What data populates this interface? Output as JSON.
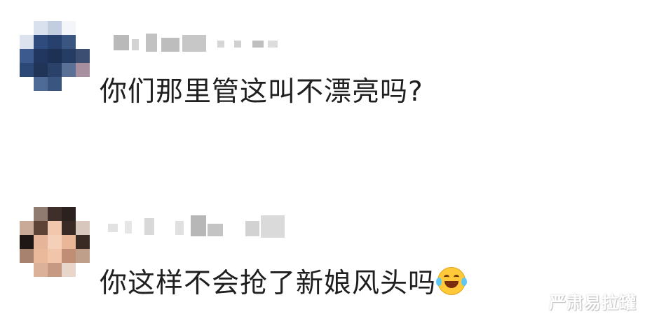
{
  "comments": [
    {
      "text": "你们那里管这叫不漂亮吗?",
      "avatar_colors": [
        "#ffffff",
        "#d9e0ee",
        "#c3cde0",
        "#f3f5f9",
        "#ffffff",
        "#dde3ee",
        "#2f4a7d",
        "#27406d",
        "#3a557f",
        "#ffffff",
        "#3c5a8d",
        "#22375f",
        "#1d3154",
        "#253c63",
        "#3c4f73",
        "#2b4876",
        "#1f3457",
        "#2a416a",
        "#5a7095",
        "#a88fa0",
        "#ffffff",
        "#4e6a97",
        "#3a5580",
        "#ffffff",
        "#ffffff"
      ]
    },
    {
      "text": "你这样不会抢了新娘风头吗",
      "emoji": "laughing-tears-emoji",
      "avatar_colors": [
        "#ffffff",
        "#8f7b70",
        "#3e2f2a",
        "#2b2220",
        "#ffffff",
        "#c9aa98",
        "#5d4236",
        "#f1c8ad",
        "#3a2a25",
        "#d8c7bd",
        "#1f1715",
        "#e6b499",
        "#f4d0b8",
        "#e9b698",
        "#3a2a24",
        "#a6826f",
        "#eab99c",
        "#f0c5aa",
        "#c08e74",
        "#bf9e8a",
        "#ffffff",
        "#dcb19a",
        "#c69a82",
        "#e8d6ca",
        "#ffffff"
      ]
    }
  ],
  "watermark": "严肃易拉罐"
}
